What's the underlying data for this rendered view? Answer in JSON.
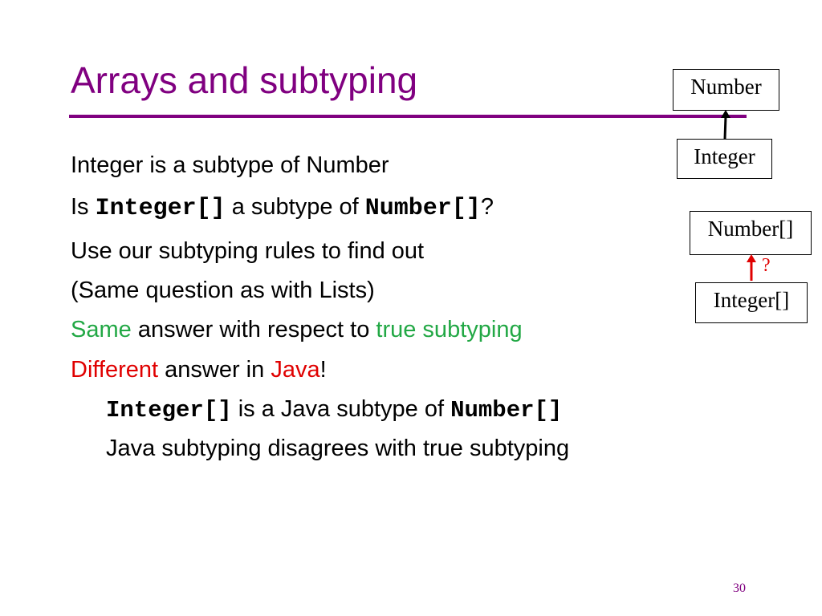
{
  "slide": {
    "title": "Arrays and subtyping",
    "page_number": "30"
  },
  "body": {
    "line1": "Integer is a subtype of Number",
    "line2": {
      "prefix": "Is ",
      "code1": "Integer[]",
      "middle": " a subtype of ",
      "code2": "Number[]",
      "suffix": "?"
    },
    "line3": "Use our subtyping rules to find out",
    "line4": "(Same question as with Lists)",
    "line5": {
      "highlight": "Same",
      "middle": " answer with respect to ",
      "highlight2": "true subtyping"
    },
    "line6": {
      "highlight": "Different",
      "middle": " answer in ",
      "highlight2": "Java",
      "suffix": "!"
    },
    "sub1": {
      "code1": "Integer[]",
      "middle": " is a Java subtype of ",
      "code2": "Number[]"
    },
    "sub2": "Java subtyping disagrees with true subtyping"
  },
  "diagram": {
    "top": {
      "super": "Number",
      "sub": "Integer"
    },
    "bottom": {
      "super": "Number[]",
      "sub": "Integer[]",
      "relation": "?"
    }
  },
  "colors": {
    "title": "#800080",
    "true_highlight": "#22a845",
    "java_highlight": "#e00000"
  }
}
